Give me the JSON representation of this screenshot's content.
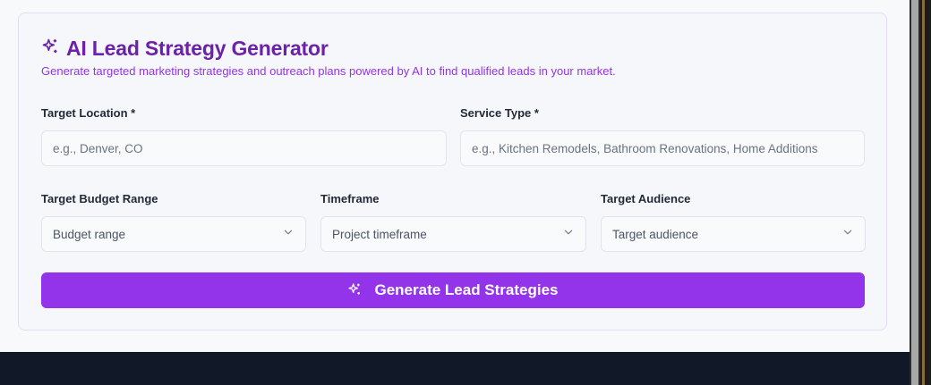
{
  "header": {
    "icon": "sparkles-icon",
    "title": "AI Lead Strategy Generator",
    "subtitle": "Generate targeted marketing strategies and outreach plans powered by AI to find qualified leads in your market."
  },
  "form": {
    "location": {
      "label": "Target Location *",
      "placeholder": "e.g., Denver, CO",
      "value": ""
    },
    "service": {
      "label": "Service Type *",
      "placeholder": "e.g., Kitchen Remodels, Bathroom Renovations, Home Additions",
      "value": ""
    },
    "budget": {
      "label": "Target Budget Range",
      "selected": "Budget range"
    },
    "timeframe": {
      "label": "Timeframe",
      "selected": "Project timeframe"
    },
    "audience": {
      "label": "Target Audience",
      "selected": "Target audience"
    }
  },
  "actions": {
    "generate_label": "Generate Lead Strategies",
    "generate_icon": "sparkles-icon"
  },
  "colors": {
    "accent": "#9333ea",
    "title": "#6b21a8",
    "footer": "#111827"
  }
}
